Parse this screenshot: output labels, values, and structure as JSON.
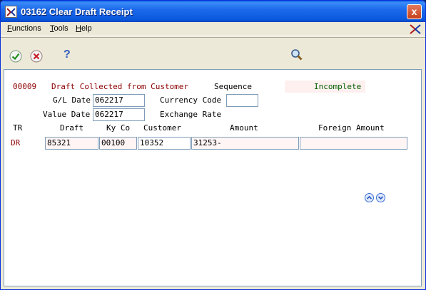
{
  "window": {
    "title": "03162  Clear Draft Receipt",
    "close_label": "x"
  },
  "menu": {
    "items": [
      {
        "first": "F",
        "rest": "unctions"
      },
      {
        "first": "T",
        "rest": "ools"
      },
      {
        "first": "H",
        "rest": "elp"
      }
    ]
  },
  "toolbar": {
    "ok_icon": "check-icon",
    "cancel_icon": "cancel-x-icon",
    "help_icon": "question-icon",
    "find_icon": "magnifier-icon",
    "help_glyph": "?"
  },
  "form": {
    "header": {
      "code": "00009",
      "description": "Draft Collected from Customer",
      "sequence_label": "Sequence",
      "sequence_value": "",
      "status": "Incomplete"
    },
    "gl_date_label": "G/L Date",
    "gl_date": "062217",
    "value_date_label": "Value Date",
    "value_date": "062217",
    "currency_code_label": "Currency Code",
    "currency_code": "",
    "exchange_rate_label": "Exchange Rate",
    "columns": {
      "tr": "TR",
      "draft": "Draft",
      "kyco": "Ky Co",
      "customer": "Customer",
      "amount": "Amount",
      "foreign_amount": "Foreign Amount"
    },
    "row": {
      "tr": "DR",
      "draft": "85321",
      "kyco": "00100",
      "customer": "10352",
      "amount": "31253-",
      "foreign_amount": ""
    }
  },
  "colors": {
    "title_bar": "#0a58dc",
    "label_red": "#8b0000",
    "status_green": "#006000",
    "field_pink": "#fff5f5"
  }
}
